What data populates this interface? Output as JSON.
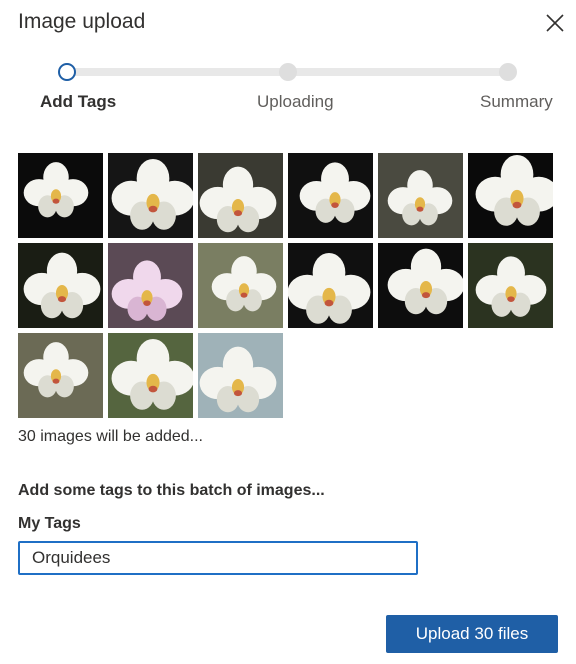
{
  "dialog": {
    "title": "Image upload",
    "close_icon": "close-icon"
  },
  "stepper": {
    "steps": [
      {
        "label": "Add Tags",
        "state": "active"
      },
      {
        "label": "Uploading",
        "state": "inactive"
      },
      {
        "label": "Summary",
        "state": "inactive"
      }
    ]
  },
  "thumbnails": {
    "count_shown": 15,
    "subject": "white orchid photos"
  },
  "batch": {
    "count_text": "30 images will be added...",
    "tags_heading": "Add some tags to this batch of images..."
  },
  "tags_field": {
    "label": "My Tags",
    "value": "Orquidees"
  },
  "actions": {
    "upload_label": "Upload 30 files"
  },
  "colors": {
    "accent": "#1f5fa6",
    "focus_border": "#1f6fc5",
    "track": "#e8e8e8"
  }
}
